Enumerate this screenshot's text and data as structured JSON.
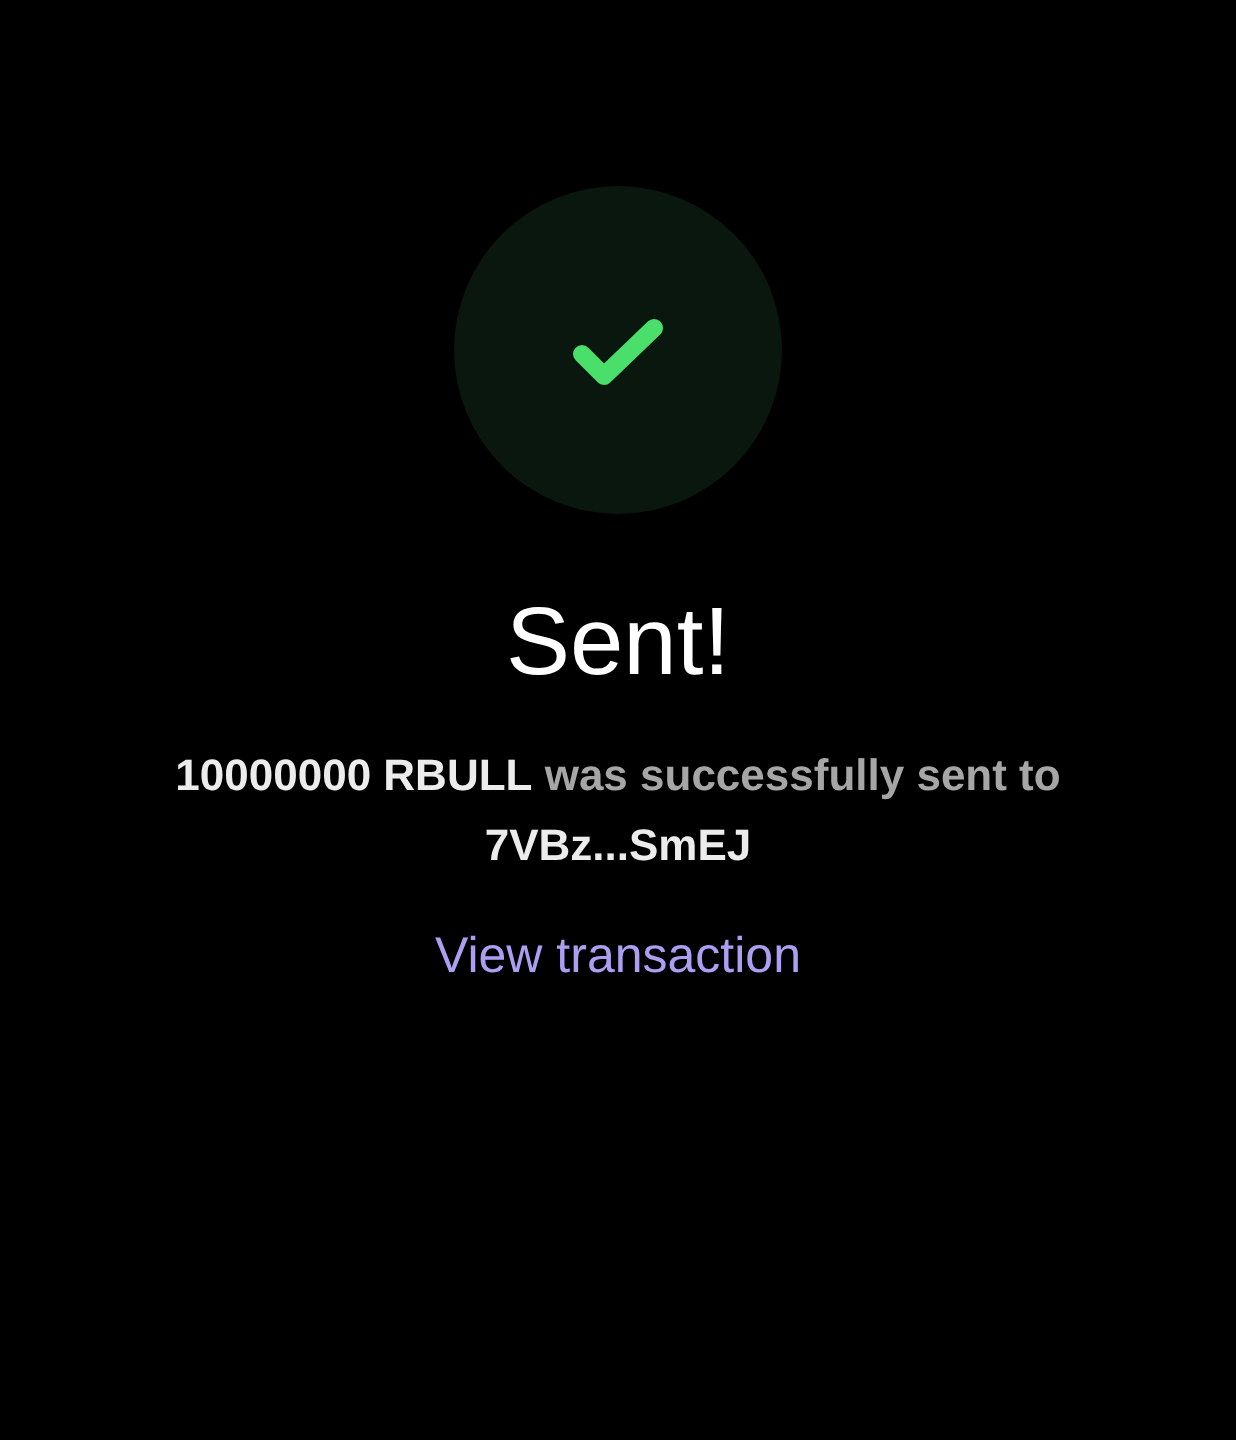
{
  "status": {
    "title": "Sent!",
    "message": "**10000000 RBULL** was successfully sent to **7VBz...SmEJ**"
  },
  "link": {
    "label": "View transaction"
  }
}
